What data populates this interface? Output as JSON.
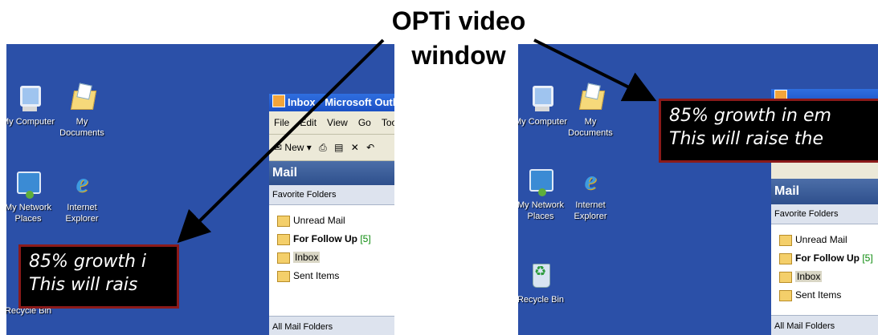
{
  "annotation": {
    "line1": "OPTi video",
    "line2": "window"
  },
  "desktop_icons": {
    "my_computer": "My Computer",
    "my_documents": "My Documents",
    "my_network_places_l1": "My Network",
    "my_network_places_l2": "Places",
    "internet_explorer_l1": "Internet",
    "internet_explorer_l2": "Explorer",
    "recycle_bin": "Recycle Bin",
    "recycle_bin_partial": "Recycle Bin"
  },
  "outlook": {
    "title": "Inbox - Microsoft Outlook",
    "menu": [
      "File",
      "Edit",
      "View",
      "Go",
      "Tools"
    ],
    "toolbar_new": "New",
    "pane_title": "Mail",
    "favorite_folders": "Favorite Folders",
    "folders": [
      {
        "label": "Unread Mail",
        "count": ""
      },
      {
        "label": "For Follow Up",
        "count": "[5]"
      },
      {
        "label": "Inbox",
        "count": ""
      },
      {
        "label": "Sent Items",
        "count": ""
      }
    ],
    "all_mail_folders": "All Mail Folders"
  },
  "captions": {
    "left_line1": "85% growth i",
    "left_line2": "This will rais",
    "right_line1": "85% growth in em",
    "right_line2": "This will raise the"
  },
  "colors": {
    "desktop": "#2b50a8",
    "caption_border": "#8b1a1a",
    "caption_bg": "#000000",
    "arrow": "#000000"
  }
}
